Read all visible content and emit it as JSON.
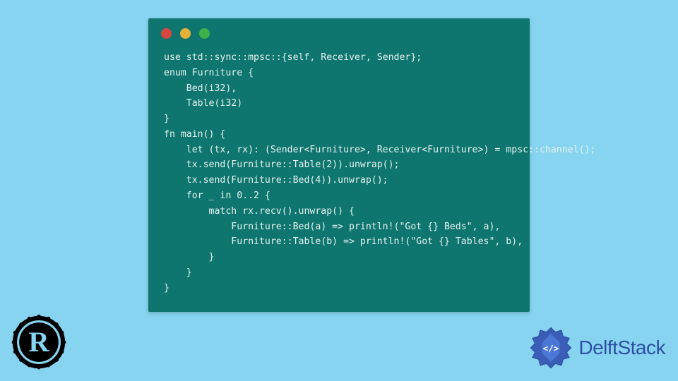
{
  "code": {
    "lines": [
      "use std::sync::mpsc::{self, Receiver, Sender};",
      "enum Furniture {",
      "    Bed(i32),",
      "    Table(i32)",
      "}",
      "fn main() {",
      "    let (tx, rx): (Sender<Furniture>, Receiver<Furniture>) = mpsc::channel();",
      "    tx.send(Furniture::Table(2)).unwrap();",
      "    tx.send(Furniture::Bed(4)).unwrap();",
      "    for _ in 0..2 {",
      "        match rx.recv().unwrap() {",
      "            Furniture::Bed(a) => println!(\"Got {} Beds\", a),",
      "            Furniture::Table(b) => println!(\"Got {} Tables\", b),",
      "        }",
      "    }",
      "}"
    ]
  },
  "branding": {
    "site_name": "DelftStack"
  }
}
